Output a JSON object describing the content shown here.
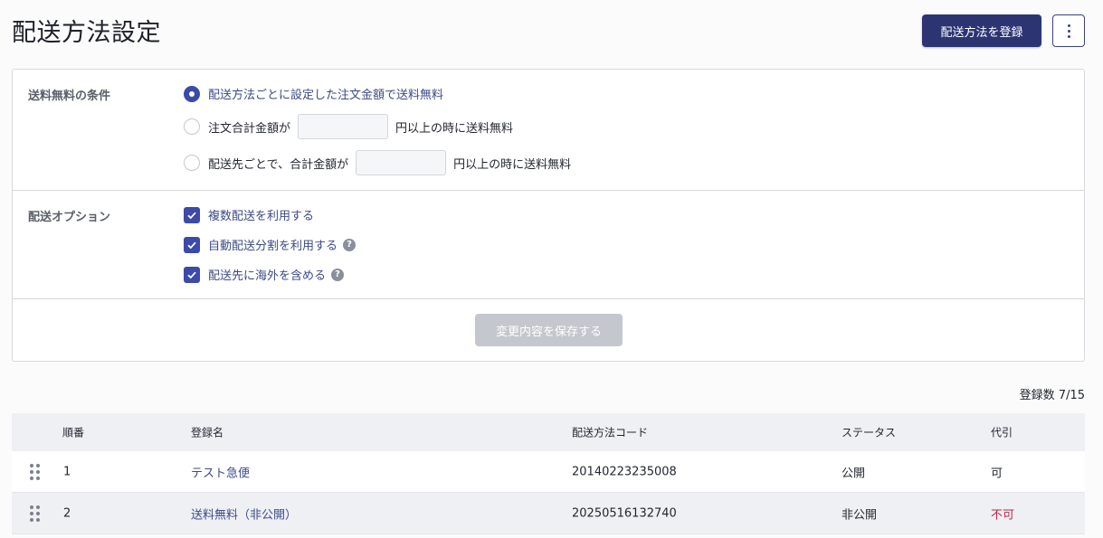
{
  "page": {
    "title": "配送方法設定"
  },
  "header": {
    "register_button": "配送方法を登録",
    "more_icon": "kebab-menu-icon"
  },
  "free_shipping": {
    "label": "送料無料の条件",
    "options": [
      {
        "text": "配送方法ごとに設定した注文金額で送料無料",
        "selected": true
      },
      {
        "prefix": "注文合計金額が",
        "value": "",
        "suffix": "円以上の時に送料無料",
        "selected": false
      },
      {
        "prefix": "配送先ごとで、合計金額が",
        "value": "",
        "suffix": "円以上の時に送料無料",
        "selected": false
      }
    ]
  },
  "delivery_options": {
    "label": "配送オプション",
    "items": [
      {
        "text": "複数配送を利用する",
        "checked": true,
        "help": false
      },
      {
        "text": "自動配送分割を利用する",
        "checked": true,
        "help": true
      },
      {
        "text": "配送先に海外を含める",
        "checked": true,
        "help": true
      }
    ],
    "help_icon": "?"
  },
  "save_button": "変更内容を保存する",
  "registration_count": "登録数 7/15",
  "table": {
    "headers": [
      "順番",
      "登録名",
      "配送方法コード",
      "ステータス",
      "代引"
    ],
    "rows": [
      {
        "order": "1",
        "name": "テスト急便",
        "code": "20140223235008",
        "status": "公開",
        "cod": "可"
      },
      {
        "order": "2",
        "name": "送料無料（非公開）",
        "code": "20250516132740",
        "status": "非公開",
        "cod": "不可"
      }
    ]
  },
  "colors": {
    "primary": "#2c3572",
    "accent": "#3c4aa8",
    "danger": "#c2264a"
  }
}
